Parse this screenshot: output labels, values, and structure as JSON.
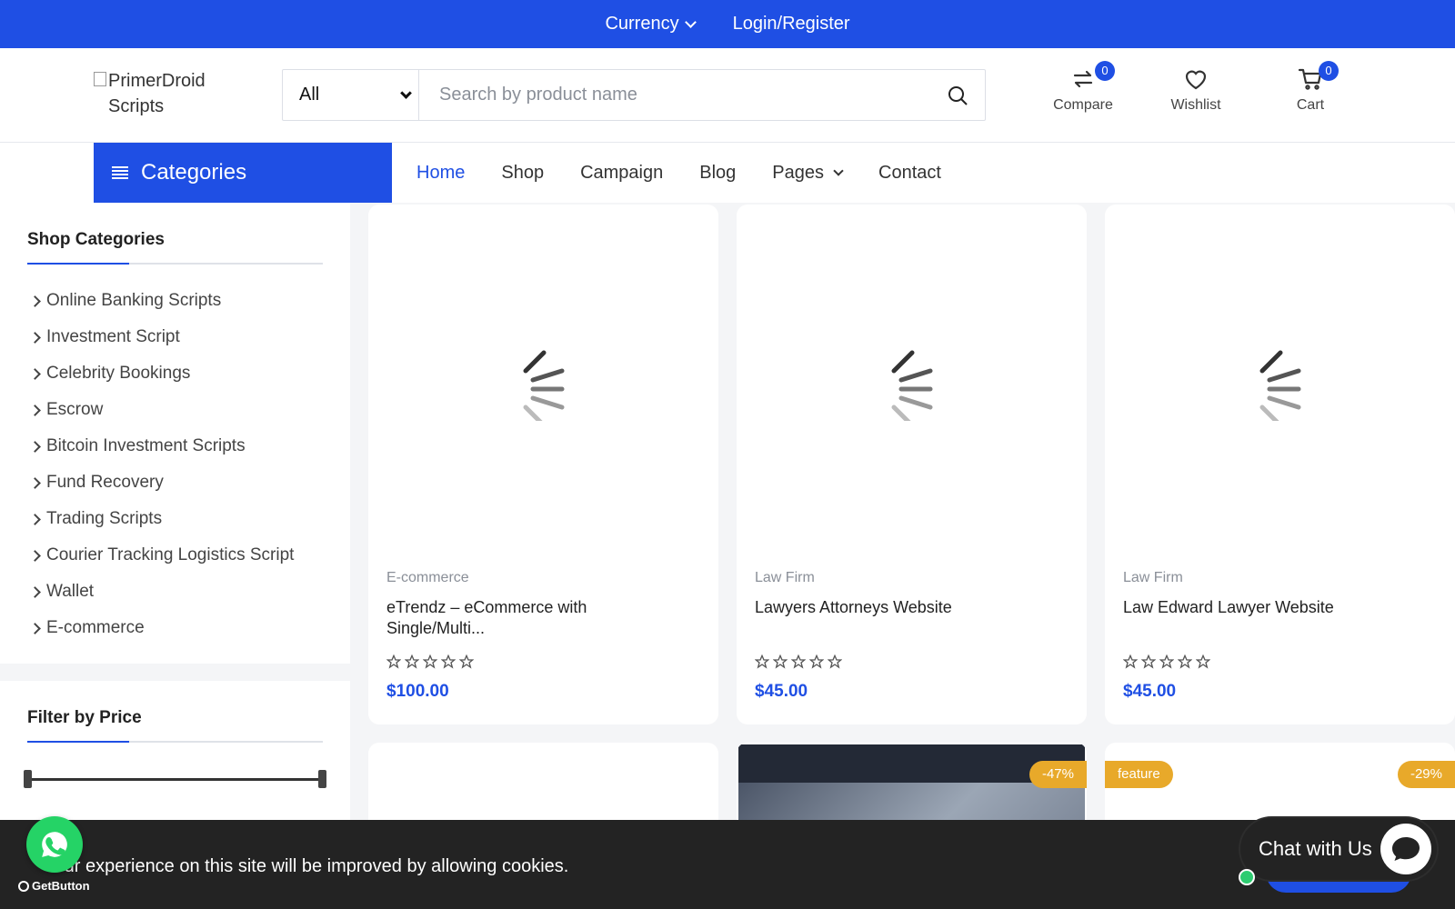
{
  "topbar": {
    "currency_label": "Currency",
    "login_label": "Login/Register"
  },
  "header": {
    "logo_alt": "PrimerDroid Scripts",
    "search": {
      "category_value": "All",
      "placeholder": "Search by product name"
    },
    "compare": {
      "label": "Compare",
      "count": "0"
    },
    "wishlist": {
      "label": "Wishlist"
    },
    "cart": {
      "label": "Cart",
      "count": "0"
    }
  },
  "nav": {
    "categories_label": "Categories",
    "links": [
      "Home",
      "Shop",
      "Campaign",
      "Blog",
      "Pages",
      "Contact"
    ]
  },
  "sidebar": {
    "title": "Shop Categories",
    "items": [
      "Online Banking Scripts",
      "Investment Script",
      "Celebrity Bookings",
      "Escrow",
      "Bitcoin Investment Scripts",
      "Fund Recovery",
      "Trading Scripts",
      "Courier Tracking Logistics Script",
      "Wallet",
      "E-commerce"
    ],
    "filter_title": "Filter by Price"
  },
  "products": [
    {
      "category": "E-commerce",
      "name": "eTrendz – eCommerce with Single/Multi...",
      "price": "$100.00",
      "rating": 0
    },
    {
      "category": "Law Firm",
      "name": "Lawyers Attorneys Website",
      "price": "$45.00",
      "rating": 0
    },
    {
      "category": "Law Firm",
      "name": "Law Edward Lawyer Website",
      "price": "$45.00",
      "rating": 0
    }
  ],
  "row2": {
    "card2_badge": "-47%",
    "card3_feature": "feature",
    "card3_badge": "-29%"
  },
  "cookie": {
    "text": "Your experience on this site will be improved by allowing cookies."
  },
  "chat": {
    "label": "Chat with Us"
  },
  "getbutton": {
    "label": "GetButton"
  },
  "colors": {
    "primary": "#1f4fe4",
    "badge": "#e8a92a",
    "dark": "#232323",
    "whatsapp": "#25d366"
  }
}
